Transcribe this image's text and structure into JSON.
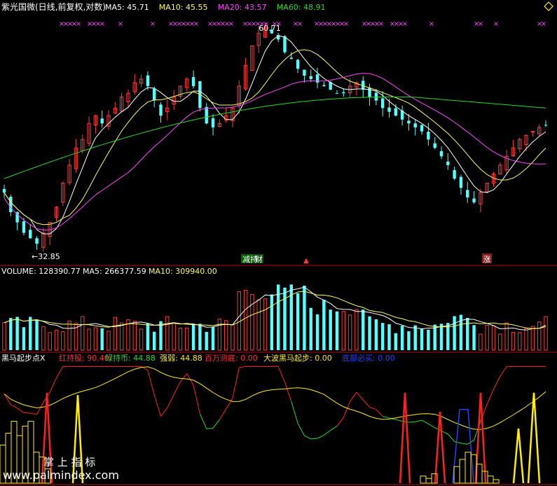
{
  "colors": {
    "bg": "#000000",
    "up": "#ff3b3b",
    "down": "#54ffff",
    "ma5": "#ffffff",
    "ma10": "#ffff55",
    "ma20": "#ff44ff",
    "ma60": "#22dd22",
    "panel_line": "#b01010",
    "strong": "#ffee00",
    "blue": "#2244ff",
    "white": "#ffffff"
  },
  "top_icon": "diamond-icon",
  "price_panel": {
    "title": "紫光国微(日线,前复权,对数)",
    "indicators": [
      {
        "label": "MA5:",
        "value": "45.71",
        "color": "#ffffff"
      },
      {
        "label": "MA10:",
        "value": "45.55",
        "color": "#ffff55"
      },
      {
        "label": "MA20:",
        "value": "43.57",
        "color": "#ff44ff"
      },
      {
        "label": "MA60:",
        "value": "48.91",
        "color": "#22dd22"
      }
    ],
    "high_label": "60.71",
    "low_label": "←32.85",
    "events": [
      {
        "text": "减持",
        "color": "#ffffff"
      },
      {
        "text": "财",
        "color": "#ffffff"
      },
      {
        "text": "▲",
        "color": "#ff3b3b"
      },
      {
        "text": "涨",
        "color": "#ffffff"
      }
    ]
  },
  "volume_panel": {
    "title": "VOLUME:",
    "value": "128390.77",
    "ma5_label": "MA5:",
    "ma5_value": "266377.59",
    "ma10_label": "MA10:",
    "ma10_value": "309940.00"
  },
  "indicator_panel": {
    "title": "黑马起步点X",
    "items": [
      {
        "label": "红持股:",
        "value": "90.40",
        "color": "#ff3030"
      },
      {
        "label": "绿持币:",
        "value": "44.88",
        "color": "#22dd22"
      },
      {
        "label": "强弱:",
        "value": "44.88",
        "color": "#ffee00"
      },
      {
        "label": "百万测底:",
        "value": "0.00",
        "color": "#ff3030"
      },
      {
        "label": "大波黑马起步:",
        "value": "0.00",
        "color": "#ffee00"
      },
      {
        "label": "底部必买:",
        "value": "0.00",
        "color": "#2244ff"
      }
    ]
  },
  "watermark": {
    "line1": "掌 上 指 标",
    "line2": "www.palmindex.com"
  },
  "chart_data": {
    "type": "candlestick",
    "x": "trading days (approx. 130 bars)",
    "price_scale": "log",
    "price_high": 60.71,
    "price_low": 32.85,
    "close_path": [
      38,
      36,
      35,
      34,
      33.5,
      33,
      34,
      35,
      36.5,
      39,
      41,
      43,
      44,
      46,
      47,
      46,
      47,
      48,
      49.5,
      50,
      51.5,
      52,
      51,
      49,
      47,
      48,
      49.5,
      51,
      52,
      51,
      48,
      46,
      45.5,
      46,
      47,
      48,
      51,
      54,
      57,
      59,
      60,
      59,
      58,
      56,
      55,
      53.5,
      52.5,
      52,
      51.5,
      51,
      50.5,
      50,
      50,
      51,
      51.5,
      50.5,
      49.5,
      49,
      48,
      47.5,
      47,
      46.5,
      46,
      45.5,
      45,
      44,
      43,
      42,
      41,
      39.5,
      38.5,
      37.5,
      37,
      38,
      39,
      40,
      41,
      42,
      43,
      44,
      44.5,
      45,
      45.5,
      45.8
    ],
    "ma5": "45.71",
    "ma10": "45.55",
    "ma20": "43.57",
    "ma60": "48.91",
    "volume_last": "128390.77",
    "indicator_last": {
      "red": "90.40",
      "green": "44.88",
      "strength": "44.88"
    }
  }
}
